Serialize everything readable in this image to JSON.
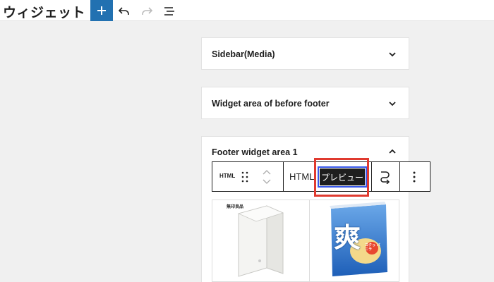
{
  "header": {
    "title": "ウィジェット",
    "add_icon": "plus-icon",
    "undo_icon": "undo-icon",
    "redo_icon": "redo-icon",
    "list_view_icon": "list-view-icon"
  },
  "panels": [
    {
      "title": "Sidebar(Media)",
      "expanded": false
    },
    {
      "title": "Widget area of before footer",
      "expanded": false
    },
    {
      "title": "Footer widget area 1",
      "expanded": true
    }
  ],
  "block_toolbar": {
    "block_type_label": "HTML",
    "html_tab": "HTML",
    "preview_tab": "プレビュー"
  },
  "preview_images": {
    "left_caption": "無印良品",
    "right_caption": "爽",
    "right_badge": "コクっ バニラ"
  },
  "colors": {
    "accent": "#2271b1",
    "highlight": "#e03a2f",
    "focus": "#3858e9"
  }
}
